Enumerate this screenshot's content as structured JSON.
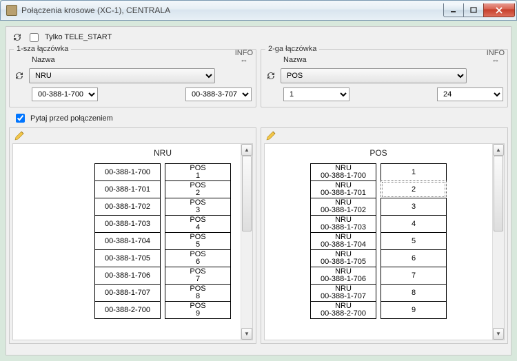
{
  "window": {
    "title": "Połączenia krosowe (XC-1),  CENTRALA"
  },
  "options": {
    "teleStartLabel": "Tylko TELE_START",
    "teleStartChecked": false,
    "askBeforeLabel": "Pytaj przed połączeniem",
    "askBeforeChecked": true,
    "info": "INFO"
  },
  "group1": {
    "legend": "1-sza łączówka",
    "nameLabel": "Nazwa",
    "nameValue": "NRU",
    "from": "00-388-1-700",
    "to": "00-388-3-707"
  },
  "group2": {
    "legend": "2-ga łączówka",
    "nameLabel": "Nazwa",
    "nameValue": "POS",
    "from": "1",
    "to": "24"
  },
  "leftPanel": {
    "title": "NRU",
    "rows": [
      {
        "a": "00-388-1-700",
        "b1": "POS",
        "b2": "1"
      },
      {
        "a": "00-388-1-701",
        "b1": "POS",
        "b2": "2"
      },
      {
        "a": "00-388-1-702",
        "b1": "POS",
        "b2": "3"
      },
      {
        "a": "00-388-1-703",
        "b1": "POS",
        "b2": "4"
      },
      {
        "a": "00-388-1-704",
        "b1": "POS",
        "b2": "5"
      },
      {
        "a": "00-388-1-705",
        "b1": "POS",
        "b2": "6"
      },
      {
        "a": "00-388-1-706",
        "b1": "POS",
        "b2": "7"
      },
      {
        "a": "00-388-1-707",
        "b1": "POS",
        "b2": "8"
      },
      {
        "a": "00-388-2-700",
        "b1": "POS",
        "b2": "9"
      }
    ]
  },
  "rightPanel": {
    "title": "POS",
    "rows": [
      {
        "a1": "NRU",
        "a2": "00-388-1-700",
        "b": "1"
      },
      {
        "a1": "NRU",
        "a2": "00-388-1-701",
        "b": "2",
        "selected": true
      },
      {
        "a1": "NRU",
        "a2": "00-388-1-702",
        "b": "3"
      },
      {
        "a1": "NRU",
        "a2": "00-388-1-703",
        "b": "4"
      },
      {
        "a1": "NRU",
        "a2": "00-388-1-704",
        "b": "5"
      },
      {
        "a1": "NRU",
        "a2": "00-388-1-705",
        "b": "6"
      },
      {
        "a1": "NRU",
        "a2": "00-388-1-706",
        "b": "7"
      },
      {
        "a1": "NRU",
        "a2": "00-388-1-707",
        "b": "8"
      },
      {
        "a1": "NRU",
        "a2": "00-388-2-700",
        "b": "9"
      }
    ]
  }
}
